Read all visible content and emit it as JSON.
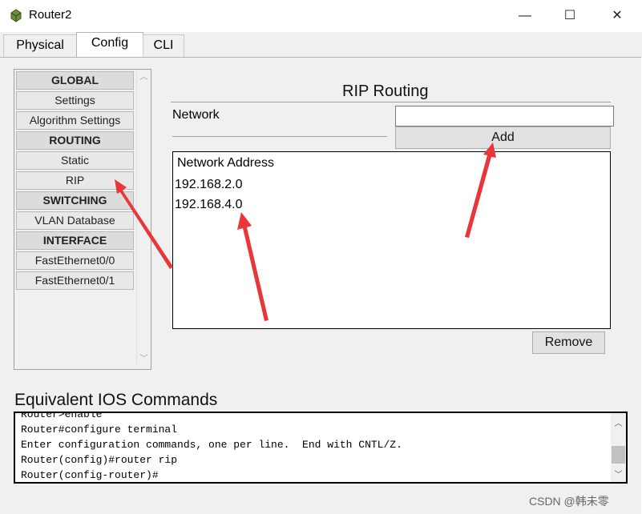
{
  "window": {
    "title": "Router2",
    "controls": {
      "minimize": "—",
      "maximize": "☐",
      "close": "✕"
    }
  },
  "tabs": [
    {
      "label": "Physical",
      "active": false
    },
    {
      "label": "Config",
      "active": true
    },
    {
      "label": "CLI",
      "active": false
    }
  ],
  "left_menu": [
    {
      "label": "GLOBAL",
      "header": true
    },
    {
      "label": "Settings",
      "header": false
    },
    {
      "label": "Algorithm Settings",
      "header": false
    },
    {
      "label": "ROUTING",
      "header": true
    },
    {
      "label": "Static",
      "header": false
    },
    {
      "label": "RIP",
      "header": false
    },
    {
      "label": "SWITCHING",
      "header": true
    },
    {
      "label": "VLAN Database",
      "header": false
    },
    {
      "label": "INTERFACE",
      "header": true
    },
    {
      "label": "FastEthernet0/0",
      "header": false
    },
    {
      "label": "FastEthernet0/1",
      "header": false
    }
  ],
  "rip": {
    "title": "RIP Routing",
    "network_label": "Network",
    "network_value": "",
    "add_button": "Add",
    "list_header": "Network Address",
    "networks": [
      "192.168.2.0",
      "192.168.4.0"
    ],
    "remove_button": "Remove"
  },
  "ios": {
    "title": "Equivalent IOS Commands",
    "lines": [
      "Router>enable",
      "Router#configure terminal",
      "Enter configuration commands, one per line.  End with CNTL/Z.",
      "Router(config)#router rip",
      "Router(config-router)#"
    ]
  },
  "watermark": "CSDN @韩未零",
  "colors": {
    "annotation_arrow": "#e8363b",
    "panel_bg": "#f0f0f0",
    "button_bg": "#e1e1e1"
  }
}
